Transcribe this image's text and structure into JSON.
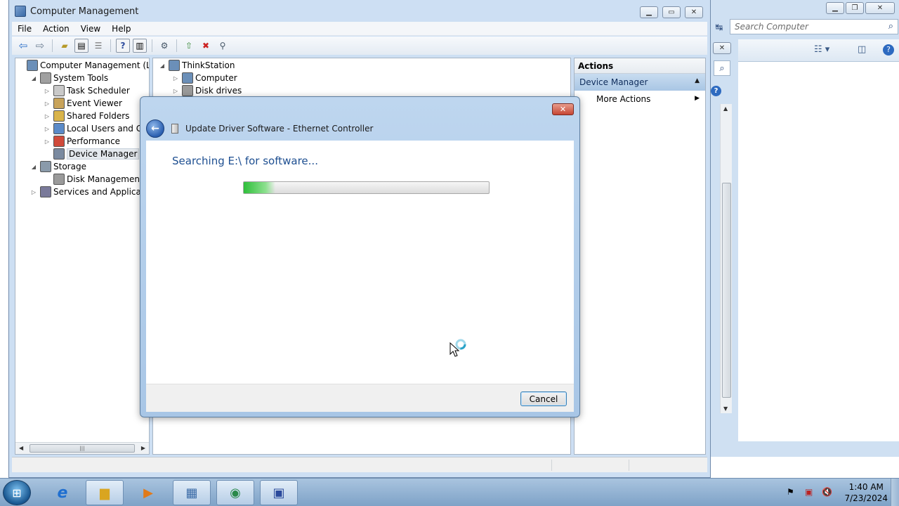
{
  "explorer": {
    "search_placeholder": "Search Computer"
  },
  "cm": {
    "title": "Computer Management",
    "menu": [
      "File",
      "Action",
      "View",
      "Help"
    ],
    "tree": [
      {
        "label": "Computer Management (Local",
        "level": 0,
        "expander": "",
        "icon": "computer-icon"
      },
      {
        "label": "System Tools",
        "level": 1,
        "expander": "◢",
        "icon": "tools-icon"
      },
      {
        "label": "Task Scheduler",
        "level": 2,
        "expander": "▷",
        "icon": "clock-icon"
      },
      {
        "label": "Event Viewer",
        "level": 2,
        "expander": "▷",
        "icon": "event-viewer-icon"
      },
      {
        "label": "Shared Folders",
        "level": 2,
        "expander": "▷",
        "icon": "shared-folders-icon"
      },
      {
        "label": "Local Users and Groups",
        "level": 2,
        "expander": "▷",
        "icon": "users-icon"
      },
      {
        "label": "Performance",
        "level": 2,
        "expander": "▷",
        "icon": "performance-icon"
      },
      {
        "label": "Device Manager",
        "level": 2,
        "expander": "",
        "icon": "device-manager-icon",
        "selected": true
      },
      {
        "label": "Storage",
        "level": 1,
        "expander": "◢",
        "icon": "storage-icon"
      },
      {
        "label": "Disk Management",
        "level": 2,
        "expander": "",
        "icon": "disk-icon"
      },
      {
        "label": "Services and Applications",
        "level": 1,
        "expander": "▷",
        "icon": "services-icon"
      }
    ],
    "devices": [
      {
        "label": "ThinkStation",
        "level": 0,
        "expander": "◢",
        "icon": "computer-icon"
      },
      {
        "label": "Computer",
        "level": 1,
        "expander": "▷",
        "icon": "computer-icon"
      },
      {
        "label": "Disk drives",
        "level": 1,
        "expander": "▷",
        "icon": "disk-drive-icon"
      }
    ],
    "actions": {
      "header": "Actions",
      "section": "Device Manager",
      "item": "More Actions"
    }
  },
  "dialog": {
    "title": "Update Driver Software - Ethernet Controller",
    "heading": "Searching E:\\ for software...",
    "progress": 0.13,
    "cancel_label": "Cancel"
  },
  "taskbar": {
    "apps": [
      "internet-explorer-icon",
      "windows-explorer-icon",
      "media-player-icon",
      "control-panel-icon",
      "update-icon",
      "network-icon"
    ],
    "time": "1:40 AM",
    "date": "7/23/2024"
  }
}
